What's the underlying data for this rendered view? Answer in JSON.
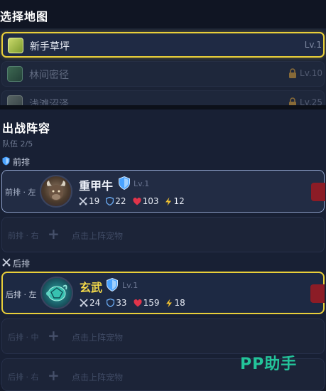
{
  "map_select": {
    "title": "选择地图",
    "maps": [
      {
        "name": "新手草坪",
        "level": "Lv.1",
        "selected": true,
        "locked": false,
        "icon": "grass-map-icon"
      },
      {
        "name": "林间密径",
        "level": "Lv.10",
        "selected": false,
        "locked": true,
        "icon": "forest-map-icon"
      },
      {
        "name": "浅滩沼泽",
        "level": "Lv.25",
        "selected": false,
        "locked": true,
        "icon": "swamp-map-icon"
      }
    ]
  },
  "lineup": {
    "title": "出战阵容",
    "team_count": "队伍 2/5",
    "front_label": "前排",
    "back_label": "后排",
    "empty_text": "点击上阵宠物",
    "front_slots": [
      {
        "slot": "前排 · 左",
        "filled": true,
        "name": "重甲牛",
        "level": "Lv.1",
        "stats": {
          "atk": "19",
          "def": "22",
          "hp": "103",
          "spd": "12"
        }
      },
      {
        "slot": "前排 · 右",
        "filled": false
      }
    ],
    "back_slots": [
      {
        "slot": "后排 · 左",
        "filled": true,
        "name": "玄武",
        "level": "Lv.1",
        "stats": {
          "atk": "24",
          "def": "33",
          "hp": "159",
          "spd": "18"
        }
      },
      {
        "slot": "后排 · 中",
        "filled": false
      },
      {
        "slot": "后排 · 右",
        "filled": false
      }
    ]
  },
  "watermark": "PP助手",
  "colors": {
    "accent_gold": "#e9cf3a",
    "shield_blue": "#4aa3ff",
    "heart_red": "#e0344a",
    "bolt_yellow": "#f1c232",
    "watermark_green": "#23c49a"
  }
}
